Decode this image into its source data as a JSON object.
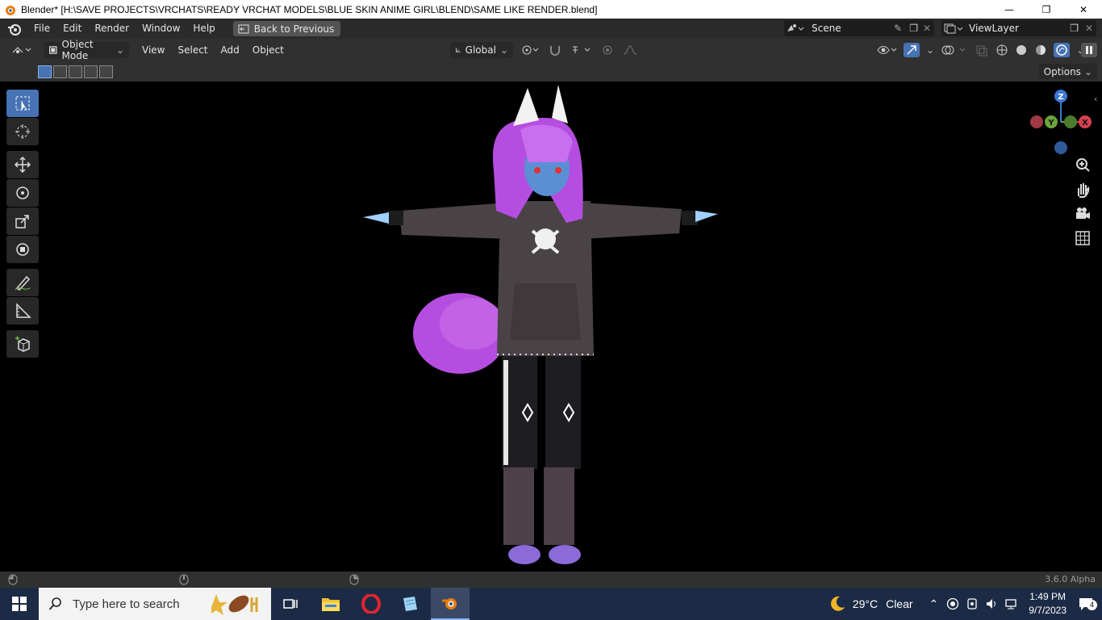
{
  "window": {
    "title": "Blender* [H:\\SAVE PROJECTS\\VRCHATS\\READY VRCHAT MODELS\\BLUE SKIN ANIME GIRL\\BLEND\\SAME LIKE RENDER.blend]",
    "minimize_glyph": "—",
    "maximize_glyph": "❐",
    "close_glyph": "✕"
  },
  "menubar": {
    "items": [
      "File",
      "Edit",
      "Render",
      "Window",
      "Help"
    ],
    "back_button": "Back to Previous",
    "scene": "Scene",
    "view_layer": "ViewLayer"
  },
  "header": {
    "mode": "Object Mode",
    "menus": [
      "View",
      "Select",
      "Add",
      "Object"
    ],
    "orientation": "Global",
    "options": "Options"
  },
  "navigation_gizmo": {
    "z_label": "Z",
    "y_label": "Y",
    "x_label": "X"
  },
  "status": {
    "version": "3.6.0 Alpha"
  },
  "taskbar": {
    "search_placeholder": "Type here to search",
    "weather_temp": "29°C",
    "weather_text": "Clear",
    "time": "1:49 PM",
    "date": "9/7/2023",
    "notifications": "4"
  },
  "colors": {
    "active_blue": "#4772b3",
    "axis_x": "#d9414e",
    "axis_y": "#6da43a",
    "axis_z": "#3d7ad6",
    "hoodie": "#4a4346",
    "hair": "#b54ee0",
    "skin": "#5b8fd4"
  }
}
